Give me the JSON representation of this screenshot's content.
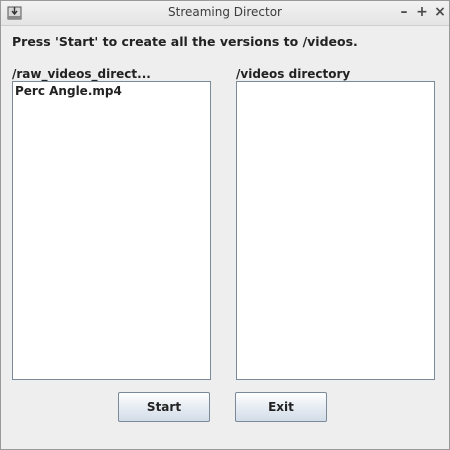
{
  "window": {
    "title": "Streaming Director",
    "controls": {
      "minimize": "–",
      "maximize": "+",
      "close": "×"
    }
  },
  "instruction": "Press 'Start' to create all the versions to /videos.",
  "raw_list": {
    "title": "/raw_videos_direct...",
    "items": [
      "Perc Angle.mp4"
    ]
  },
  "videos_list": {
    "title": "/videos directory",
    "items": []
  },
  "buttons": {
    "start": "Start",
    "exit": "Exit"
  }
}
